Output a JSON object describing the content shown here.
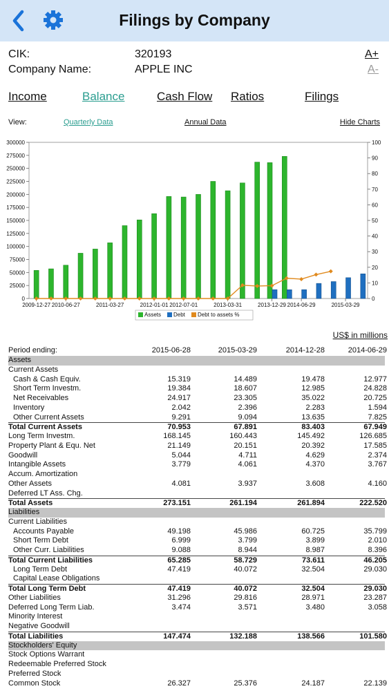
{
  "header": {
    "title": "Filings by Company",
    "back_icon": "chevron-left-icon",
    "settings_icon": "gear-icon"
  },
  "company": {
    "cik_label": "CIK:",
    "cik_value": "320193",
    "name_label": "Company Name:",
    "name_value": "APPLE INC",
    "font_bigger": "A+",
    "font_smaller": "A-"
  },
  "tabs": [
    {
      "label": "Income",
      "active": false
    },
    {
      "label": "Balance",
      "active": true
    },
    {
      "label": "Cash Flow",
      "active": false
    },
    {
      "label": "Ratios",
      "active": false
    },
    {
      "label": "Filings",
      "active": false
    }
  ],
  "view": {
    "label": "View:",
    "quarterly": "Quarterly Data",
    "annual": "Annual  Data",
    "hide_charts": "Hide Charts"
  },
  "colors": {
    "assets": "#2db52d",
    "debt": "#1f6fc0",
    "ratio": "#e08a1e",
    "accent": "#2a9d8f",
    "nav_bg": "#d4e5f7",
    "section_bg": "#c4c4c4"
  },
  "chart_data": {
    "type": "bar",
    "categories": [
      "2009-12-27",
      "2010-03-27",
      "2010-06-27",
      "2010-09-25",
      "2010-12-25",
      "2011-03-27",
      "2011-06-25",
      "2011-09-24",
      "2012-01-01",
      "2012-03-31",
      "2012-07-01",
      "2012-09-29",
      "2012-12-29",
      "2013-03-31",
      "2013-06-29",
      "2013-09-28",
      "2013-12-29",
      "2014-03-29",
      "2014-06-29",
      "2014-09-27",
      "2014-12-27",
      "2015-03-29",
      "2015-06-28"
    ],
    "x_tick_labels": [
      "2009-12-27",
      "2010-06-27",
      "2011-03-27",
      "2012-01-01",
      "2012-07-01",
      "2013-03-31",
      "2013-12-29",
      "2014-06-29",
      "2015-03-29"
    ],
    "series": [
      {
        "name": "Assets",
        "axis": "left",
        "values": [
          54000,
          57000,
          64000,
          87000,
          95000,
          107000,
          140000,
          151000,
          163000,
          196000,
          195000,
          200000,
          225000,
          207000,
          222000,
          262000,
          261000,
          273000
        ],
        "start_index": 0
      },
      {
        "name": "Debt",
        "axis": "left",
        "values": [
          17000,
          16900,
          17000,
          29000,
          32500,
          40000,
          47400
        ],
        "start_index": 16
      },
      {
        "name": "Debt to assets %",
        "axis": "right",
        "values": [
          0,
          0,
          0,
          0,
          0,
          0,
          0,
          0,
          0,
          0,
          0,
          0,
          0,
          0,
          8.5,
          8.0,
          8.2,
          13.0,
          12.4,
          15.3,
          17.4
        ],
        "start_index": 0
      }
    ],
    "left_ylim": [
      0,
      300000
    ],
    "left_ticks": [
      0,
      25000,
      50000,
      75000,
      100000,
      125000,
      150000,
      175000,
      200000,
      225000,
      250000,
      275000,
      300000
    ],
    "right_ylim": [
      0,
      100
    ],
    "right_ticks": [
      0,
      10,
      20,
      30,
      40,
      50,
      60,
      70,
      80,
      90,
      100
    ],
    "legend": [
      "Assets",
      "Debt",
      "Debt to assets %"
    ],
    "legend_position": "bottom"
  },
  "table": {
    "units": "US$ in millions",
    "period_label": "Period ending:",
    "periods": [
      "2015-06-28",
      "2015-03-29",
      "2014-12-28",
      "2014-06-29"
    ],
    "rows": [
      {
        "label": "Assets",
        "type": "section"
      },
      {
        "label": "Current Assets"
      },
      {
        "label": "Cash & Cash Equiv.",
        "indent": true,
        "values": [
          "15.319",
          "14.489",
          "19.478",
          "12.977"
        ]
      },
      {
        "label": "Short Term Investm.",
        "indent": true,
        "values": [
          "19.384",
          "18.607",
          "12.985",
          "24.828"
        ]
      },
      {
        "label": "Net Receivables",
        "indent": true,
        "values": [
          "24.917",
          "23.305",
          "35.022",
          "20.725"
        ]
      },
      {
        "label": "Inventory",
        "indent": true,
        "values": [
          "2.042",
          "2.396",
          "2.283",
          "1.594"
        ]
      },
      {
        "label": "Other Current Assets",
        "indent": true,
        "values": [
          "9.291",
          "9.094",
          "13.635",
          "7.825"
        ]
      },
      {
        "label": "Total Current Assets",
        "type": "total",
        "values": [
          "70.953",
          "67.891",
          "83.403",
          "67.949"
        ]
      },
      {
        "label": "Long Term Investm.",
        "values": [
          "168.145",
          "160.443",
          "145.492",
          "126.685"
        ]
      },
      {
        "label": "Property Plant & Equ. Net",
        "values": [
          "21.149",
          "20.151",
          "20.392",
          "17.585"
        ]
      },
      {
        "label": "Goodwill",
        "values": [
          "5.044",
          "4.711",
          "4.629",
          "2.374"
        ]
      },
      {
        "label": "Intangible Assets",
        "values": [
          "3.779",
          "4.061",
          "4.370",
          "3.767"
        ]
      },
      {
        "label": "Accum. Amortization"
      },
      {
        "label": "Other Assets",
        "values": [
          "4.081",
          "3.937",
          "3.608",
          "4.160"
        ]
      },
      {
        "label": "Deferred LT Ass. Chg."
      },
      {
        "label": "Total Assets",
        "type": "total",
        "values": [
          "273.151",
          "261.194",
          "261.894",
          "222.520"
        ]
      },
      {
        "label": "Liabilities",
        "type": "section"
      },
      {
        "label": "Current Liabilities"
      },
      {
        "label": "Accounts Payable",
        "indent": true,
        "values": [
          "49.198",
          "45.986",
          "60.725",
          "35.799"
        ]
      },
      {
        "label": "Short Term Debt",
        "indent": true,
        "values": [
          "6.999",
          "3.799",
          "3.899",
          "2.010"
        ]
      },
      {
        "label": "Other Curr. Liabilities",
        "indent": true,
        "values": [
          "9.088",
          "8.944",
          "8.987",
          "8.396"
        ]
      },
      {
        "label": "Total Current Liabilities",
        "type": "total",
        "values": [
          "65.285",
          "58.729",
          "73.611",
          "46.205"
        ]
      },
      {
        "label": "Long Term Debt",
        "indent": true,
        "values": [
          "47.419",
          "40.072",
          "32.504",
          "29.030"
        ]
      },
      {
        "label": "Capital Lease Obligations",
        "indent": true
      },
      {
        "label": "Total Long Term Debt",
        "type": "total",
        "values": [
          "47.419",
          "40.072",
          "32.504",
          "29.030"
        ]
      },
      {
        "label": "Other Liabilities",
        "values": [
          "31.296",
          "29.816",
          "28.971",
          "23.287"
        ]
      },
      {
        "label": "Deferred Long Term Liab.",
        "values": [
          "3.474",
          "3.571",
          "3.480",
          "3.058"
        ]
      },
      {
        "label": "Minority Interest"
      },
      {
        "label": "Negative Goodwill"
      },
      {
        "label": "Total Liabilities",
        "type": "total",
        "values": [
          "147.474",
          "132.188",
          "138.566",
          "101.580"
        ]
      },
      {
        "label": "Stockholders' Equity",
        "type": "section"
      },
      {
        "label": "Stock Options Warrant"
      },
      {
        "label": "Redeemable Preferred Stock"
      },
      {
        "label": "Preferred Stock"
      },
      {
        "label": "Common Stock",
        "values": [
          "26.327",
          "25.376",
          "24.187",
          "22.139"
        ]
      }
    ]
  }
}
